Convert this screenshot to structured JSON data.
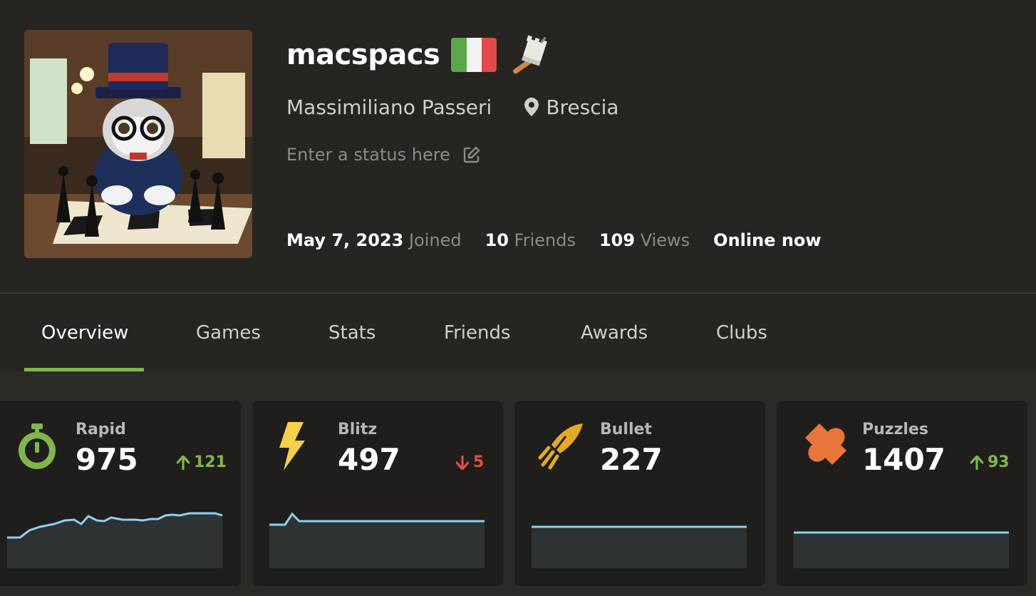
{
  "profile": {
    "username": "macspacs",
    "country_flag": "Italy",
    "full_name": "Massimiliano Passeri",
    "location": "Brescia",
    "status_placeholder": "Enter a status here",
    "joined_value": "May 7, 2023",
    "joined_label": "Joined",
    "friends_value": "10",
    "friends_label": "Friends",
    "views_value": "109",
    "views_label": "Views",
    "online": "Online now"
  },
  "tabs": [
    {
      "label": "Overview",
      "active": true
    },
    {
      "label": "Games"
    },
    {
      "label": "Stats"
    },
    {
      "label": "Friends"
    },
    {
      "label": "Awards"
    },
    {
      "label": "Clubs"
    }
  ],
  "cards": [
    {
      "title": "Rapid",
      "rating": "975",
      "delta": "121",
      "delta_dir": "up",
      "icon": "stopwatch-icon"
    },
    {
      "title": "Blitz",
      "rating": "497",
      "delta": "5",
      "delta_dir": "down",
      "icon": "lightning-icon"
    },
    {
      "title": "Bullet",
      "rating": "227",
      "delta": "",
      "delta_dir": "",
      "icon": "bullet-icon"
    },
    {
      "title": "Puzzles",
      "rating": "1407",
      "delta": "93",
      "delta_dir": "up",
      "icon": "puzzle-icon"
    }
  ],
  "colors": {
    "background": "#262522",
    "accent_green": "#81b64c",
    "up": "#81b64c",
    "down": "#e54b3c",
    "spark_line": "#8fd0f0",
    "rapid_icon": "#81b64c",
    "blitz_icon": "#f5d04a",
    "bullet_icon": "#e3aa24",
    "puzzle_icon": "#e8763a"
  }
}
